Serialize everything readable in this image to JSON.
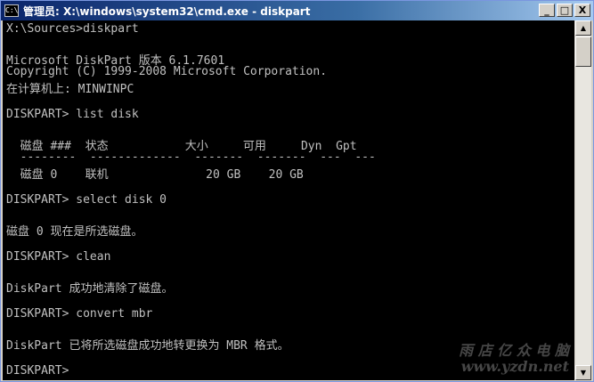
{
  "window": {
    "title": "管理员: X:\\windows\\system32\\cmd.exe - diskpart",
    "icon_label": "C:\\",
    "buttons": {
      "minimize": "_",
      "maximize": "□",
      "close": "X"
    }
  },
  "console": {
    "lines": [
      "X:\\Sources>diskpart",
      "",
      "Microsoft DiskPart 版本 6.1.7601",
      "Copyright (C) 1999-2008 Microsoft Corporation.",
      "在计算机上: MINWINPC",
      "",
      "DISKPART> list disk",
      "",
      "  磁盘 ###  状态           大小     可用     Dyn  Gpt",
      "  --------  -------------  -------  -------  ---  ---",
      "  磁盘 0    联机              20 GB    20 GB",
      "",
      "DISKPART> select disk 0",
      "",
      "磁盘 0 现在是所选磁盘。",
      "",
      "DISKPART> clean",
      "",
      "DiskPart 成功地清除了磁盘。",
      "",
      "DISKPART> convert mbr",
      "",
      "DiskPart 已将所选磁盘成功地转更换为 MBR 格式。",
      "",
      "DISKPART>"
    ],
    "watermark_line1": "雨 店 亿 众 电 脑",
    "watermark_line2": "www.yzdn.net"
  },
  "scrollbar": {
    "up_arrow": "▲",
    "down_arrow": "▼"
  }
}
